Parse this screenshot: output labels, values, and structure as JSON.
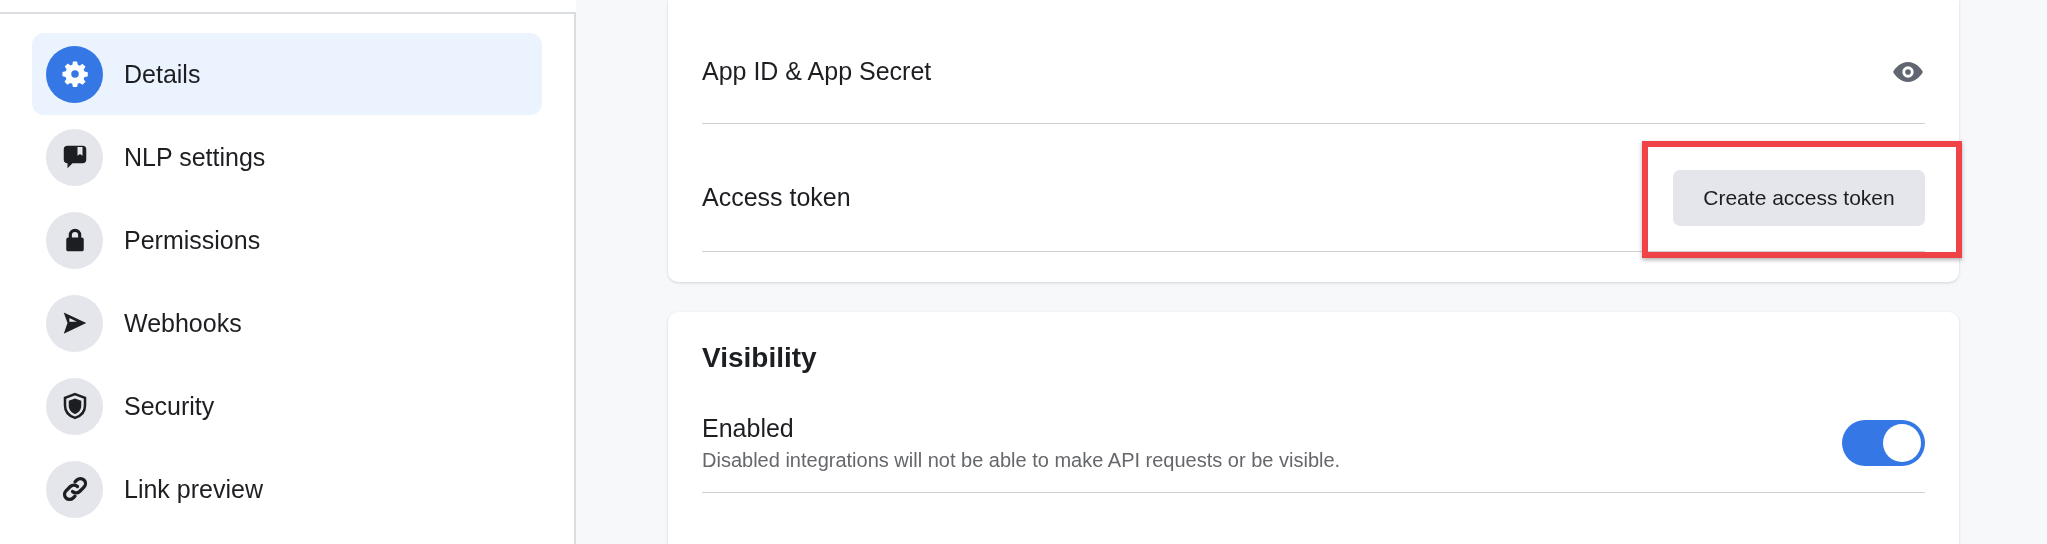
{
  "sidebar": {
    "items": [
      {
        "label": "Details",
        "selected": true
      },
      {
        "label": "NLP settings",
        "selected": false
      },
      {
        "label": "Permissions",
        "selected": false
      },
      {
        "label": "Webhooks",
        "selected": false
      },
      {
        "label": "Security",
        "selected": false
      },
      {
        "label": "Link preview",
        "selected": false
      }
    ]
  },
  "credentials_card": {
    "rows": [
      {
        "label": "App ID & App Secret",
        "kind": "reveal"
      },
      {
        "label": "Access token",
        "kind": "button",
        "button": "Create access token",
        "highlighted": true
      }
    ]
  },
  "visibility_card": {
    "title": "Visibility",
    "setting": {
      "label": "Enabled",
      "description": "Disabled integrations will not be able to make API requests or be visible.",
      "on": true
    }
  }
}
